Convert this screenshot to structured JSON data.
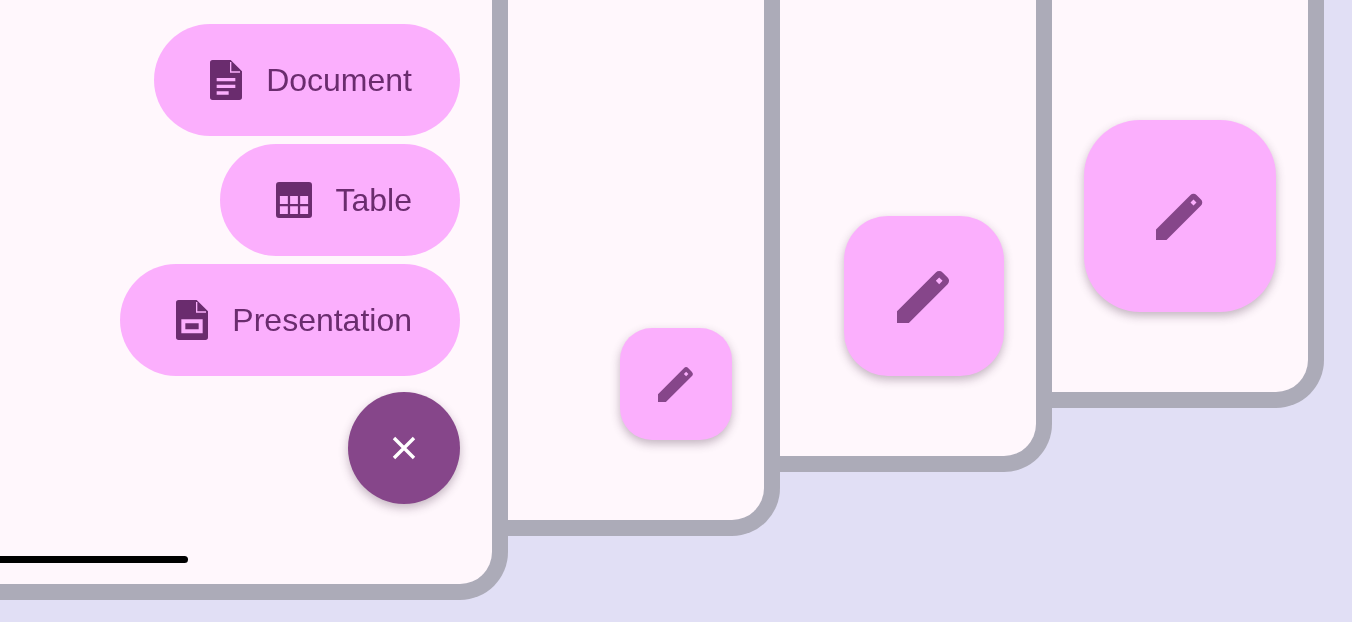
{
  "phones": [
    {
      "kind": "fab_menu",
      "expanded": true,
      "menu_items": [
        {
          "label": "Document"
        },
        {
          "label": "Table"
        },
        {
          "label": "Presentation"
        }
      ]
    },
    {
      "kind": "small_fab"
    },
    {
      "kind": "medium_fab"
    },
    {
      "kind": "large_fab"
    }
  ]
}
